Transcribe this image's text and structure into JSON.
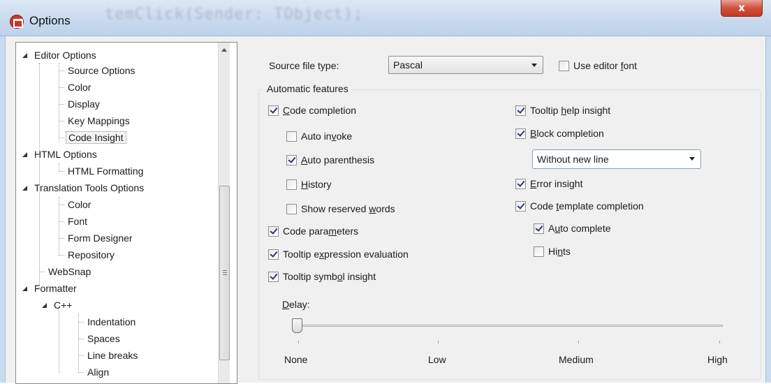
{
  "window": {
    "title": "Options",
    "ghost_code": "temClick(Sender: TObject);",
    "close_label": "x"
  },
  "tree": {
    "items": [
      {
        "label": "Editor Options",
        "expanded": true
      },
      {
        "label": "Source Options"
      },
      {
        "label": "Color"
      },
      {
        "label": "Display"
      },
      {
        "label": "Key Mappings"
      },
      {
        "label": "Code Insight",
        "selected": true
      },
      {
        "label": "HTML Options",
        "expanded": true
      },
      {
        "label": "HTML Formatting"
      },
      {
        "label": "Translation Tools Options",
        "expanded": true
      },
      {
        "label": "Color"
      },
      {
        "label": "Font"
      },
      {
        "label": "Form Designer"
      },
      {
        "label": "Repository"
      },
      {
        "label": "WebSnap"
      },
      {
        "label": "Formatter",
        "expanded": true
      },
      {
        "label": "C++",
        "expanded": true
      },
      {
        "label": "Indentation"
      },
      {
        "label": "Spaces"
      },
      {
        "label": "Line breaks"
      },
      {
        "label": "Align"
      }
    ]
  },
  "source_file_type": {
    "label_pre": "Source file type:",
    "value": "Pascal"
  },
  "use_editor_font": {
    "pre": "Use editor ",
    "u": "f",
    "post": "ont",
    "checked": false
  },
  "automatic_features": {
    "title": "Automatic features",
    "left": [
      {
        "pre": "",
        "u": "C",
        "post": "ode completion",
        "checked": true
      },
      {
        "pre": "Auto in",
        "u": "v",
        "post": "oke",
        "checked": false
      },
      {
        "pre": "",
        "u": "A",
        "post": "uto parenthesis",
        "checked": true
      },
      {
        "pre": "",
        "u": "H",
        "post": "istory",
        "checked": false
      },
      {
        "pre": "Show reserved ",
        "u": "w",
        "post": "ords",
        "checked": false
      },
      {
        "pre": "Code para",
        "u": "m",
        "post": "eters",
        "checked": true
      },
      {
        "pre": "Tooltip e",
        "u": "x",
        "post": "pression evaluation",
        "checked": true
      },
      {
        "pre": "Tooltip symb",
        "u": "o",
        "post": "l insight",
        "checked": true
      }
    ],
    "right": [
      {
        "pre": "Tooltip ",
        "u": "h",
        "post": "elp insight",
        "checked": true
      },
      {
        "pre": "",
        "u": "B",
        "post": "lock completion",
        "checked": true
      },
      {
        "pre": "",
        "u": "E",
        "post": "rror insight",
        "checked": true
      },
      {
        "pre": "Code ",
        "u": "t",
        "post": "emplate completion",
        "checked": true
      },
      {
        "pre": "A",
        "u": "u",
        "post": "to complete",
        "checked": true
      },
      {
        "pre": "Hi",
        "u": "n",
        "post": "ts",
        "checked": false
      }
    ],
    "block_completion_option": "Without new line"
  },
  "delay": {
    "pre": "",
    "u": "D",
    "post": "elay:",
    "value_index": 0,
    "labels": [
      "None",
      "Low",
      "Medium",
      "High"
    ]
  }
}
